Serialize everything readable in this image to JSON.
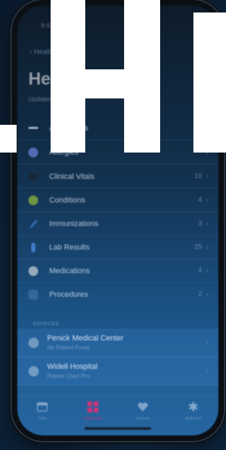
{
  "status_bar": {
    "time": "9:41"
  },
  "nav": {
    "back_label": "Health"
  },
  "header": {
    "title": "Health Records",
    "subtitle": "Updated Today"
  },
  "categories": [
    {
      "label": "All Records",
      "count": "",
      "color": "#d7e3ef",
      "icon": "list-icon"
    },
    {
      "label": "Allergies",
      "count": "",
      "color": "#6a7fd9",
      "icon": "allergy-icon"
    },
    {
      "label": "Clinical Vitals",
      "count": "10",
      "color": "#1b2530",
      "icon": "vitals-icon"
    },
    {
      "label": "Conditions",
      "count": "4",
      "color": "#8bb540",
      "icon": "stethoscope-icon"
    },
    {
      "label": "Immunizations",
      "count": "3",
      "color": "#3a7ccf",
      "icon": "syringe-icon"
    },
    {
      "label": "Lab Results",
      "count": "25",
      "color": "#4f8fe8",
      "icon": "lab-icon"
    },
    {
      "label": "Medications",
      "count": "4",
      "color": "#c0c8d2",
      "icon": "pill-icon"
    },
    {
      "label": "Procedures",
      "count": "2",
      "color": "#3f6fa5",
      "icon": "procedure-icon"
    }
  ],
  "sources": {
    "header": "SOURCES",
    "items": [
      {
        "name": "Penick Medical Center",
        "sub": "My Patient Portal"
      },
      {
        "name": "Widell Hospital",
        "sub": "Patient Chart Pro"
      }
    ]
  },
  "tabs": [
    {
      "label": "Today",
      "icon": "today-icon",
      "active": false
    },
    {
      "label": "Health Data",
      "icon": "health-data-icon",
      "active": true,
      "accent": "#c4357a"
    },
    {
      "label": "Sources",
      "icon": "heart-icon",
      "active": false
    },
    {
      "label": "Medical ID",
      "icon": "medical-id-icon",
      "active": false
    }
  ]
}
